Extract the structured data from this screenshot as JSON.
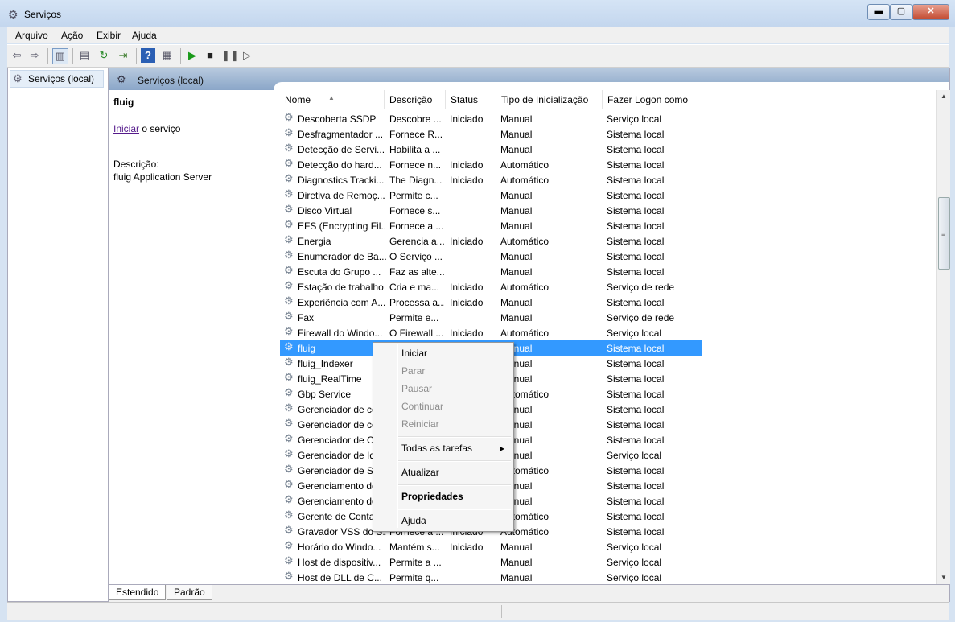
{
  "window": {
    "title": "Serviços",
    "minimize": "▬",
    "maximize": "▢",
    "close": "✕"
  },
  "menu": [
    "Arquivo",
    "Ação",
    "Exibir",
    "Ajuda"
  ],
  "tree": {
    "root": "Serviços (local)"
  },
  "panel": {
    "header": "Serviços (local)"
  },
  "detail": {
    "name": "fluig",
    "start_link": "Iniciar",
    "start_suffix": " o serviço",
    "desc_label": "Descrição:",
    "desc_text": "fluig Application Server"
  },
  "columns": [
    "Nome",
    "Descrição",
    "Status",
    "Tipo de Inicialização",
    "Fazer Logon como"
  ],
  "rows": [
    [
      "Descoberta SSDP",
      "Descobre ...",
      "Iniciado",
      "Manual",
      "Serviço local"
    ],
    [
      "Desfragmentador ...",
      "Fornece R...",
      "",
      "Manual",
      "Sistema local"
    ],
    [
      "Detecção de Servi...",
      "Habilita a ...",
      "",
      "Manual",
      "Sistema local"
    ],
    [
      "Detecção do hard...",
      "Fornece n...",
      "Iniciado",
      "Automático",
      "Sistema local"
    ],
    [
      "Diagnostics Tracki...",
      "The Diagn...",
      "Iniciado",
      "Automático",
      "Sistema local"
    ],
    [
      "Diretiva de Remoç...",
      "Permite c...",
      "",
      "Manual",
      "Sistema local"
    ],
    [
      "Disco Virtual",
      "Fornece s...",
      "",
      "Manual",
      "Sistema local"
    ],
    [
      "EFS (Encrypting Fil...",
      "Fornece a ...",
      "",
      "Manual",
      "Sistema local"
    ],
    [
      "Energia",
      "Gerencia a...",
      "Iniciado",
      "Automático",
      "Sistema local"
    ],
    [
      "Enumerador de Ba...",
      "O Serviço ...",
      "",
      "Manual",
      "Sistema local"
    ],
    [
      "Escuta do Grupo ...",
      "Faz as alte...",
      "",
      "Manual",
      "Sistema local"
    ],
    [
      "Estação de trabalho",
      "Cria e ma...",
      "Iniciado",
      "Automático",
      "Serviço de rede"
    ],
    [
      "Experiência com A...",
      "Processa a...",
      "Iniciado",
      "Manual",
      "Sistema local"
    ],
    [
      "Fax",
      "Permite e...",
      "",
      "Manual",
      "Serviço de rede"
    ],
    [
      "Firewall do Windo...",
      "O Firewall ...",
      "Iniciado",
      "Automático",
      "Serviço local"
    ],
    [
      "fluig",
      "",
      "",
      "Manual",
      "Sistema local"
    ],
    [
      "fluig_Indexer",
      "",
      "",
      "Manual",
      "Sistema local"
    ],
    [
      "fluig_RealTime",
      "",
      "",
      "Manual",
      "Sistema local"
    ],
    [
      "Gbp Service",
      "",
      "",
      "Automático",
      "Sistema local"
    ],
    [
      "Gerenciador de co",
      "",
      "",
      "Manual",
      "Sistema local"
    ],
    [
      "Gerenciador de co",
      "",
      "",
      "Manual",
      "Sistema local"
    ],
    [
      "Gerenciador de Cr",
      "",
      "",
      "Manual",
      "Sistema local"
    ],
    [
      "Gerenciador de Id",
      "",
      "",
      "Manual",
      "Serviço local"
    ],
    [
      "Gerenciador de Se",
      "",
      "",
      "Automático",
      "Sistema local"
    ],
    [
      "Gerenciamento de",
      "",
      "",
      "Manual",
      "Sistema local"
    ],
    [
      "Gerenciamento de",
      "",
      "",
      "Manual",
      "Sistema local"
    ],
    [
      "Gerente de Contas",
      "",
      "",
      "Automático",
      "Sistema local"
    ],
    [
      "Gravador VSS do S...",
      "Fornece a ...",
      "Iniciado",
      "Automático",
      "Sistema local"
    ],
    [
      "Horário do Windo...",
      "Mantém s...",
      "Iniciado",
      "Manual",
      "Serviço local"
    ],
    [
      "Host de dispositiv...",
      "Permite a ...",
      "",
      "Manual",
      "Serviço local"
    ],
    [
      "Host de DLL de C...",
      "Permite q...",
      "",
      "Manual",
      "Serviço local"
    ]
  ],
  "context_menu": {
    "start": "Iniciar",
    "stop": "Parar",
    "pause": "Pausar",
    "resume": "Continuar",
    "restart": "Reiniciar",
    "all_tasks": "Todas as tarefas",
    "refresh": "Atualizar",
    "properties": "Propriedades",
    "help": "Ajuda"
  },
  "tabs": [
    "Estendido",
    "Padrão"
  ]
}
